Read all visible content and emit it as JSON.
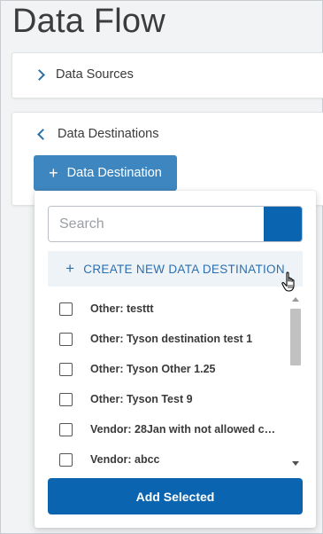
{
  "page": {
    "title": "Data Flow"
  },
  "sources_panel": {
    "label": "Data Sources"
  },
  "destinations_panel": {
    "label": "Data Destinations",
    "add_button_label": "Data Destination",
    "add_button_icon": "+"
  },
  "dropdown": {
    "search_placeholder": "Search",
    "search_value": "",
    "create_new_icon": "+",
    "create_new_label": "CREATE NEW DATA DESTINATION",
    "items": [
      {
        "label": "Other: testtt",
        "checked": false
      },
      {
        "label": "Other: Tyson destination test 1",
        "checked": false
      },
      {
        "label": "Other: Tyson Other 1.25",
        "checked": false
      },
      {
        "label": "Other: Tyson Test 9",
        "checked": false
      },
      {
        "label": "Vendor: 28Jan with not allowed ch…",
        "checked": false
      },
      {
        "label": "Vendor: abcc",
        "checked": false
      }
    ],
    "add_selected_label": "Add Selected"
  },
  "colors": {
    "primary": "#0b64b0",
    "button_light": "#3e86c0",
    "link": "#2c6fae",
    "background": "#f1f3f4"
  }
}
